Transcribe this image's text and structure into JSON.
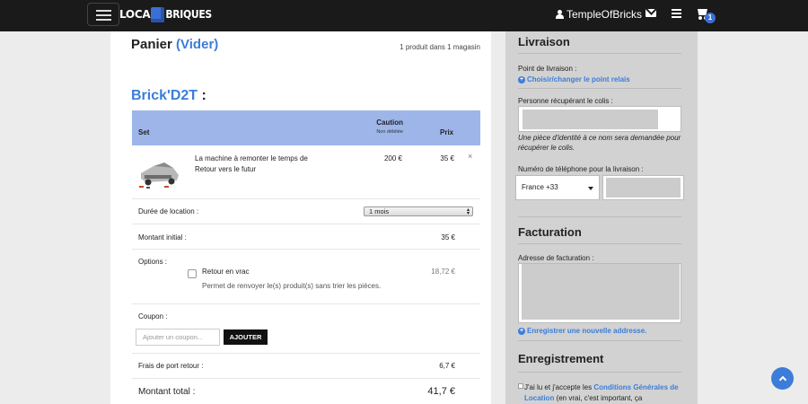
{
  "header": {
    "logo_left": "LOCA",
    "logo_right": "BRIQUES",
    "username": "TempleOfBricks",
    "cart_count": "1",
    "colors": {
      "bar": "#1a1a1a",
      "accent": "#3b7dd8"
    },
    "icons": [
      "menu-icon",
      "user-icon",
      "mail-icon",
      "list-icon",
      "cart-icon"
    ]
  },
  "cart": {
    "title": "Panier",
    "paren_open": "(",
    "clear_label": "Vider",
    "paren_close": ")",
    "summary": "1 produit dans 1 magasin",
    "shop_name": "Brick'D2T",
    "shop_colon": ":",
    "table_headers": {
      "set": "Set",
      "caution": "Caution",
      "caution_sub": "Non débitée",
      "price": "Prix"
    },
    "product": {
      "name": "La machine à remonter le temps de Retour vers le futur",
      "caution": "200 €",
      "price": "35 €",
      "remove": "×"
    },
    "duration_label": "Durée de location :",
    "duration_value": "1 mois",
    "initial_label": "Montant initial :",
    "initial_value": "35 €",
    "options_label": "Options :",
    "option_name": "Retour en vrac",
    "option_desc": "Permet de renvoyer le(s) produit(s) sans trier les pièces.",
    "option_price": "18,72 €",
    "coupon_label": "Coupon :",
    "coupon_placeholder": "Ajouter un coupon...",
    "coupon_button": "AJOUTER",
    "shipping_label": "Frais de port retour :",
    "shipping_value": "6,7 €",
    "total_label": "Montant total :",
    "total_value": "41,7 €"
  },
  "side": {
    "delivery_title": "Livraison",
    "pickup_label": "Point de livraison :",
    "pickup_link": "Choisir/changer le point relais",
    "person_label": "Personne récupérant le colis :",
    "id_note": "Une pièce d'identité à ce nom sera demandée pour récupérer le colis.",
    "phone_label": "Numéro de téléphone pour la livraison :",
    "phone_country": "France +33",
    "billing_title": "Facturation",
    "billing_label": "Adresse de facturation :",
    "save_address_link": "Enregistrer une nouvelle addresse.",
    "register_title": "Enregistrement",
    "terms_prefix": "J'ai lu et j'accepte les ",
    "terms_link": "Conditions Générales de Location",
    "terms_suffix": " (en vrai, c'est important, ça"
  }
}
